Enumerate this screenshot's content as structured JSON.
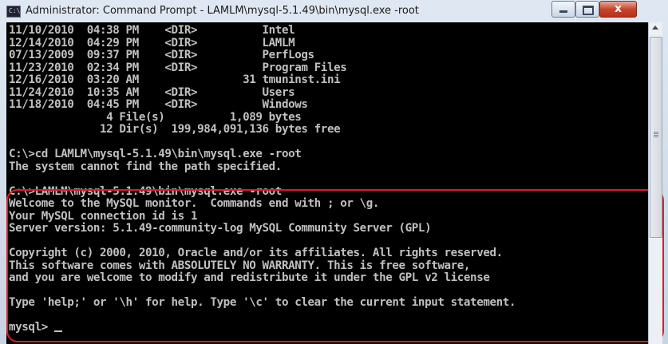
{
  "window": {
    "icon_label": "C:\\",
    "title": "Administrator: Command Prompt - LAMLM\\mysql-5.1.49\\bin\\mysql.exe  -root",
    "close_glyph": "x"
  },
  "console": {
    "lines": [
      "11/10/2010  04:38 PM    <DIR>          Intel",
      "12/14/2010  04:29 PM    <DIR>          LAMLM",
      "07/13/2009  09:37 PM    <DIR>          PerfLogs",
      "11/23/2010  02:34 PM    <DIR>          Program Files",
      "12/16/2010  03:20 AM                31 tmuninst.ini",
      "11/24/2010  10:35 AM    <DIR>          Users",
      "11/18/2010  04:45 PM    <DIR>          Windows",
      "               4 File(s)          1,089 bytes",
      "              12 Dir(s)  199,984,091,136 bytes free",
      "",
      "C:\\>cd LAMLM\\mysql-5.1.49\\bin\\mysql.exe -root",
      "The system cannot find the path specified.",
      "",
      "C:\\>LAMLM\\mysql-5.1.49\\bin\\mysql.exe -root",
      "Welcome to the MySQL monitor.  Commands end with ; or \\g.",
      "Your MySQL connection id is 1",
      "Server version: 5.1.49-community-log MySQL Community Server (GPL)",
      "",
      "Copyright (c) 2000, 2010, Oracle and/or its affiliates. All rights reserved.",
      "This software comes with ABSOLUTELY NO WARRANTY. This is free software,",
      "and you are welcome to modify and redistribute it under the GPL v2 license",
      "",
      "Type 'help;' or '\\h' for help. Type '\\c' to clear the current input statement.",
      ""
    ],
    "prompt": "mysql> "
  },
  "colors": {
    "console_bg": "#000000",
    "console_text": "#c0c0c0",
    "highlight": "#e41c1c"
  }
}
